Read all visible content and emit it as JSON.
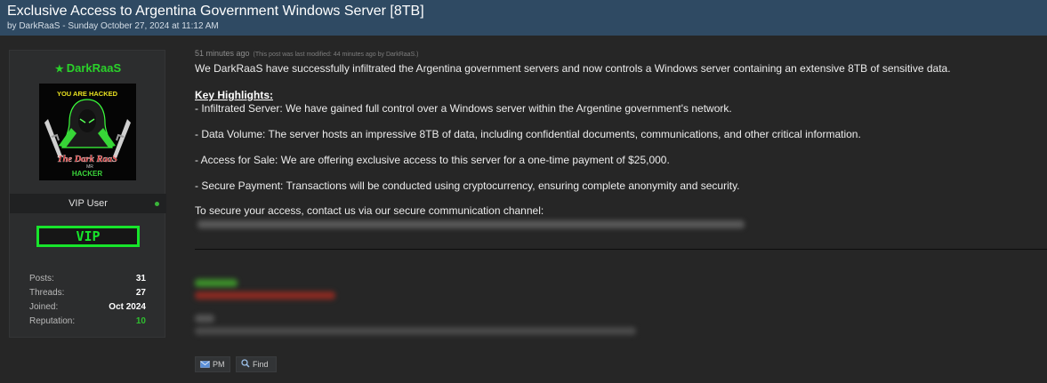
{
  "thread": {
    "title": "Exclusive Access to Argentina Government Windows Server [8TB]",
    "meta": "by DarkRaaS - Sunday October 27, 2024 at 11:12 AM"
  },
  "user": {
    "name": "DarkRaaS",
    "avatar_text_top": "YOU ARE HACKED",
    "avatar_text_name": "The Dark RaaS",
    "avatar_text_mr": "MR",
    "avatar_text_bottom": "HACKER",
    "title": "VIP User",
    "badge": "VIP",
    "stats": [
      {
        "label": "Posts:",
        "value": "31"
      },
      {
        "label": "Threads:",
        "value": "27"
      },
      {
        "label": "Joined:",
        "value": "Oct 2024"
      },
      {
        "label": "Reputation:",
        "value": "10"
      }
    ]
  },
  "post": {
    "time": "51 minutes ago",
    "edit_note": "(This post was last modified: 44 minutes ago by DarkRaaS.)",
    "lines": [
      "We DarkRaaS have successfully infiltrated the Argentina government servers and now controls a Windows server containing an extensive 8TB of sensitive data.",
      "Key Highlights:",
      "- Infiltrated Server: We have gained full control over a Windows server within the Argentine government's network.",
      "- Data Volume: The server hosts an impressive 8TB of data, including confidential documents, communications, and other critical information.",
      "- Access for Sale: We are offering exclusive access to this server for a one-time payment of $25,000.",
      "- Secure Payment: Transactions will be conducted using cryptocurrency, ensuring complete anonymity and security.",
      "To secure your access, contact us via our secure communication channel:"
    ]
  },
  "buttons": {
    "pm": "PM",
    "find": "Find"
  },
  "colors": {
    "header_bg": "#2f4a63",
    "username": "#2ad22a",
    "vip": "#17e42b",
    "reputation": "#2fbf2f"
  },
  "icons": {
    "username": "star-icon",
    "pm": "envelope-icon",
    "find": "search-icon",
    "online": "online-dot-icon"
  }
}
